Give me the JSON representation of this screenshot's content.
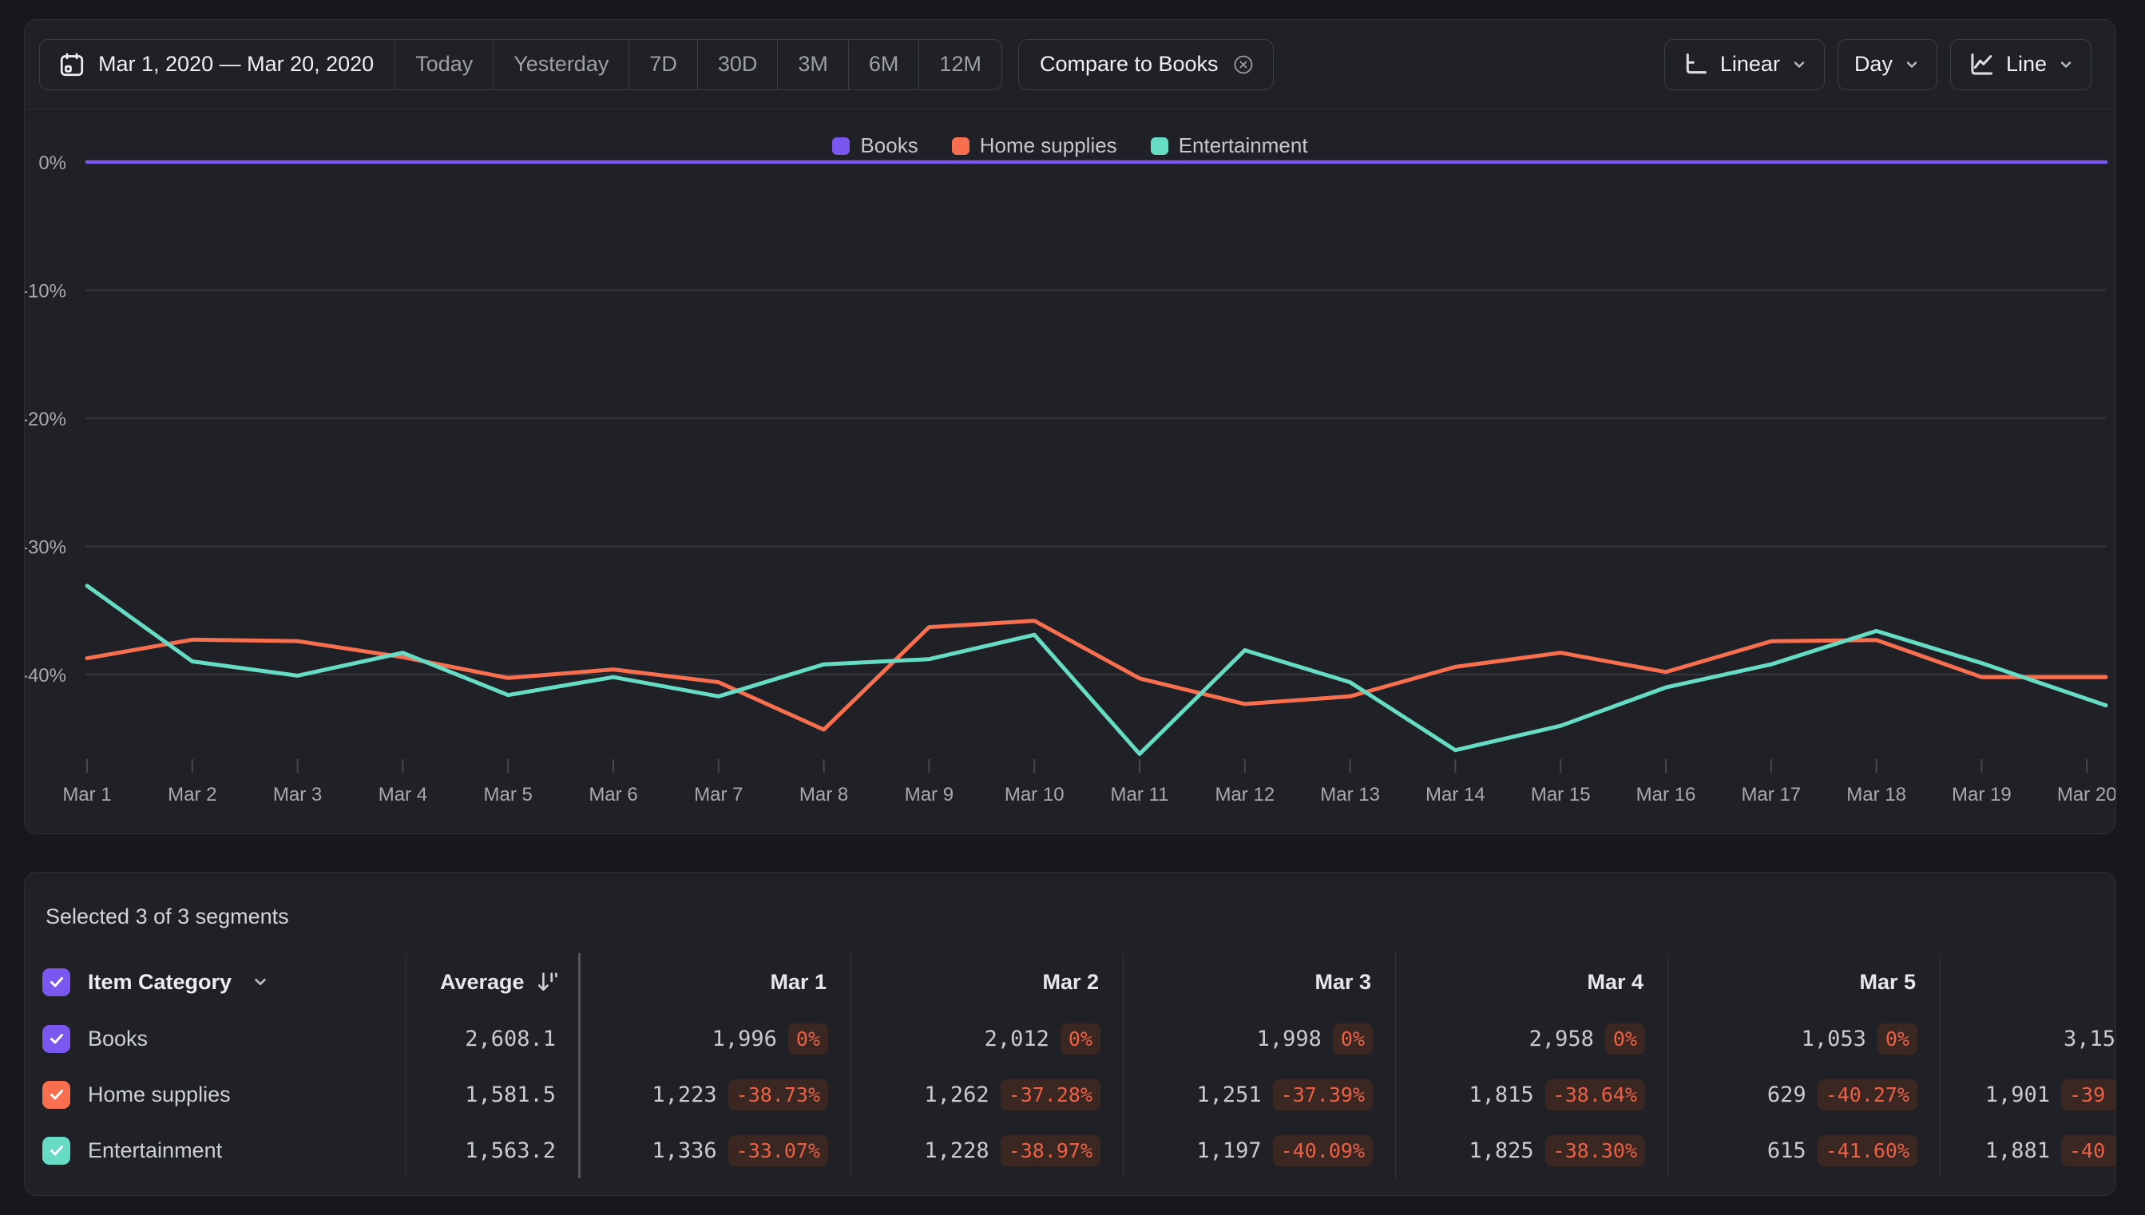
{
  "toolbar": {
    "date_range": "Mar 1, 2020 — Mar 20, 2020",
    "quick_ranges": [
      "Today",
      "Yesterday",
      "7D",
      "30D",
      "3M",
      "6M",
      "12M"
    ],
    "compare_chip_label": "Compare to Books",
    "scale_label": "Linear",
    "interval_label": "Day",
    "chart_type_label": "Line"
  },
  "legend": [
    {
      "label": "Books",
      "color": "#7a58f0"
    },
    {
      "label": "Home supplies",
      "color": "#f76f4e"
    },
    {
      "label": "Entertainment",
      "color": "#66dcc5"
    }
  ],
  "chart_data": {
    "type": "line",
    "title": "",
    "x": [
      "Mar 1",
      "Mar 2",
      "Mar 3",
      "Mar 4",
      "Mar 5",
      "Mar 6",
      "Mar 7",
      "Mar 8",
      "Mar 9",
      "Mar 10",
      "Mar 11",
      "Mar 12",
      "Mar 13",
      "Mar 14",
      "Mar 15",
      "Mar 16",
      "Mar 17",
      "Mar 18",
      "Mar 19",
      "Mar 20"
    ],
    "ytick_labels": [
      "0%",
      "-10%",
      "-20%",
      "-30%",
      "-40%"
    ],
    "yticks": [
      0,
      -10,
      -20,
      -30,
      -40
    ],
    "ylim": [
      -48,
      2
    ],
    "grid": "horizontal",
    "legend_position": "top-center",
    "series": [
      {
        "name": "Books",
        "color": "#7a58f0",
        "values": [
          0,
          0,
          0,
          0,
          0,
          0,
          0,
          0,
          0,
          0,
          0,
          0,
          0,
          0,
          0,
          0,
          0,
          0,
          0,
          0
        ]
      },
      {
        "name": "Home supplies",
        "color": "#f76f4e",
        "values": [
          -38.73,
          -37.28,
          -37.39,
          -38.64,
          -40.27,
          -39.6,
          -40.6,
          -44.3,
          -36.3,
          -35.8,
          -40.3,
          -42.3,
          -41.7,
          -39.4,
          -38.3,
          -39.8,
          -37.4,
          -37.3,
          -40.2,
          -40.2
        ]
      },
      {
        "name": "Entertainment",
        "color": "#66dcc5",
        "values": [
          -33.07,
          -38.97,
          -40.09,
          -38.3,
          -41.6,
          -40.2,
          -41.7,
          -39.2,
          -38.8,
          -36.9,
          -46.2,
          -38.1,
          -40.6,
          -45.9,
          -44.0,
          -41.0,
          -39.2,
          -36.6,
          -39.1,
          -41.9
        ]
      }
    ]
  },
  "table": {
    "selected_text": "Selected 3 of 3 segments",
    "category_header": "Item Category",
    "average_header": "Average",
    "day_headers": [
      "Mar 1",
      "Mar 2",
      "Mar 3",
      "Mar 4",
      "Mar 5"
    ],
    "rows": [
      {
        "label": "Books",
        "color": "#7a58f0",
        "average": "2,608.1",
        "cells": [
          {
            "value": "1,996",
            "pct": "0%"
          },
          {
            "value": "2,012",
            "pct": "0%"
          },
          {
            "value": "1,998",
            "pct": "0%"
          },
          {
            "value": "2,958",
            "pct": "0%"
          },
          {
            "value": "1,053",
            "pct": "0%"
          }
        ],
        "partial": {
          "value": "3,15",
          "pct": ""
        }
      },
      {
        "label": "Home supplies",
        "color": "#f76f4e",
        "average": "1,581.5",
        "cells": [
          {
            "value": "1,223",
            "pct": "-38.73%"
          },
          {
            "value": "1,262",
            "pct": "-37.28%"
          },
          {
            "value": "1,251",
            "pct": "-37.39%"
          },
          {
            "value": "1,815",
            "pct": "-38.64%"
          },
          {
            "value": "629",
            "pct": "-40.27%"
          }
        ],
        "partial": {
          "value": "1,901",
          "pct": "-39"
        }
      },
      {
        "label": "Entertainment",
        "color": "#66dcc5",
        "average": "1,563.2",
        "cells": [
          {
            "value": "1,336",
            "pct": "-33.07%"
          },
          {
            "value": "1,228",
            "pct": "-38.97%"
          },
          {
            "value": "1,197",
            "pct": "-40.09%"
          },
          {
            "value": "1,825",
            "pct": "-38.30%"
          },
          {
            "value": "615",
            "pct": "-41.60%"
          }
        ],
        "partial": {
          "value": "1,881",
          "pct": "-40"
        }
      }
    ]
  },
  "colors": {
    "accent_purple": "#7a58f0",
    "accent_orange": "#f76f4e",
    "accent_teal": "#66dcc5",
    "badge_bg": "#3a2722",
    "badge_text": "#ef5f44",
    "gridline": "#34363c"
  }
}
